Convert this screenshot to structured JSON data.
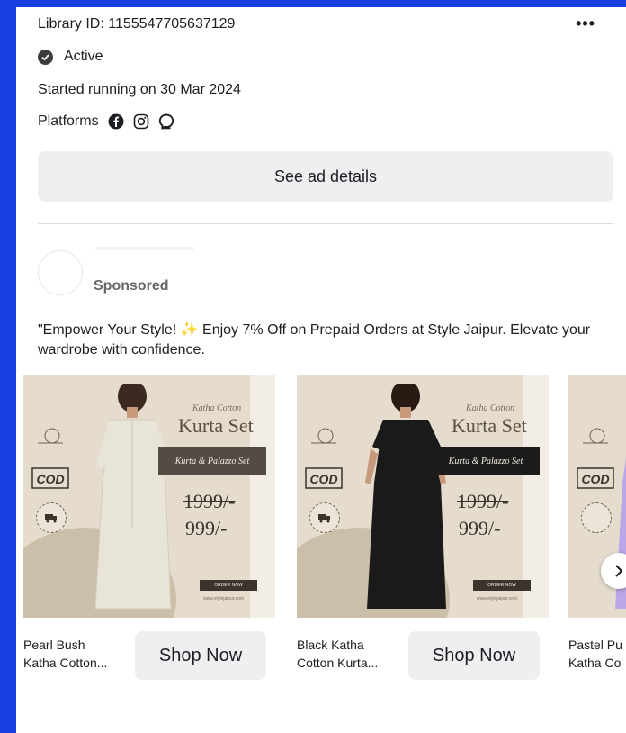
{
  "header": {
    "library_id": "Library ID: 1155547705637129",
    "more_label": "•••"
  },
  "status": {
    "label": "Active"
  },
  "started": "Started running on 30 Mar 2024",
  "platforms": {
    "label": "Platforms",
    "icons": [
      "facebook-icon",
      "instagram-icon",
      "messenger-icon"
    ]
  },
  "see_ad_details": "See ad details",
  "advertiser": {
    "sponsored": "Sponsored"
  },
  "ad_text": {
    "before": "\"Empower Your Style!",
    "after": " Enjoy 7% Off on Prepaid Orders at Style Jaipur. Elevate your wardrobe with confidence."
  },
  "cards": [
    {
      "caption_line1": "Pearl Bush",
      "caption_line2": "Katha Cotton...",
      "button": "Shop Now",
      "product_small": "Katha Cotton",
      "product_big": "Kurta Set",
      "banner": "Kurta & Palazzo Set",
      "old_price": "1999/-",
      "new_price": "999/-",
      "order": "ORDER NOW",
      "site": "www.stylejaipur.com",
      "dress_color": "#e8e4d8"
    },
    {
      "caption_line1": "Black Katha",
      "caption_line2": "Cotton Kurta...",
      "button": "Shop Now",
      "product_small": "Katha Cotton",
      "product_big": "Kurta Set",
      "banner": "Kurta & Palazzo Set",
      "old_price": "1999/-",
      "new_price": "999/-",
      "order": "ORDER NOW",
      "site": "www.stylejaipur.com",
      "dress_color": "#1a1a1a"
    },
    {
      "caption_line1": "Pastel Pu",
      "caption_line2": "Katha Co",
      "dress_color": "#b9a7e8"
    }
  ],
  "colors": {
    "background": "#1a3fe0",
    "button_bg": "#eeeff1",
    "muted_text": "#65676b"
  }
}
